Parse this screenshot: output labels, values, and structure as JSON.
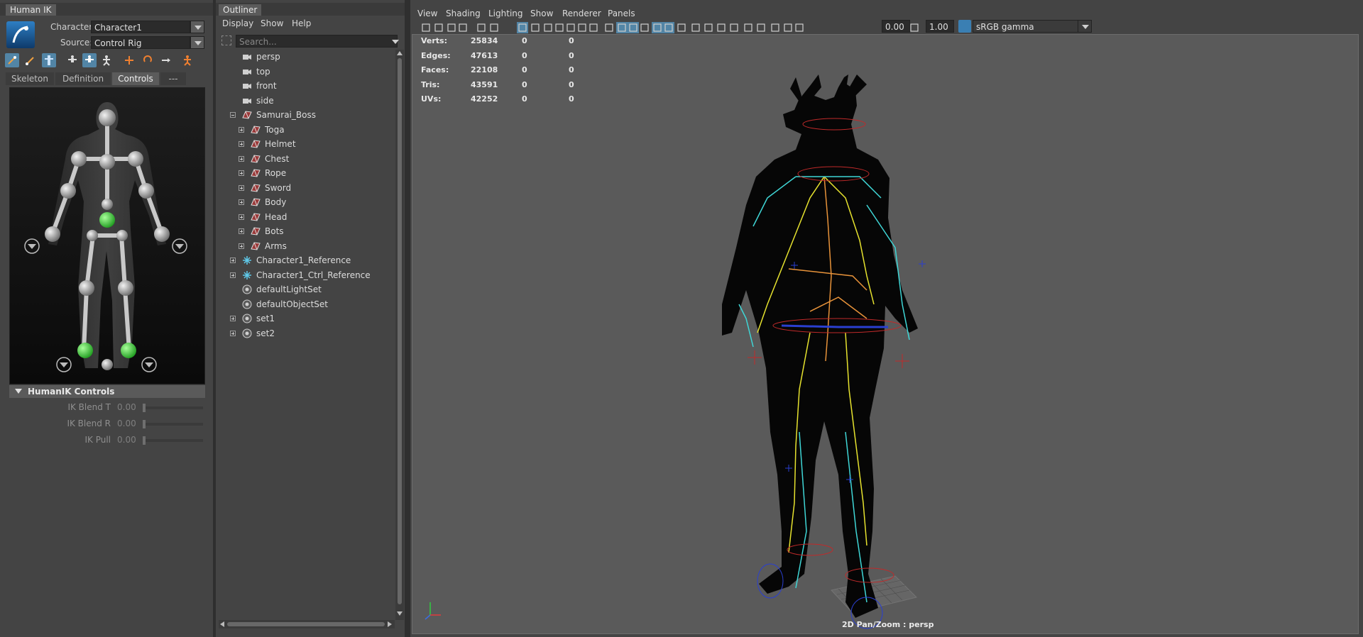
{
  "humanik": {
    "tab_title": "Human IK",
    "character_label": "Character:",
    "character_value": "Character1",
    "source_label": "Source:",
    "source_value": "Control Rig",
    "subtabs": [
      "Skeleton",
      "Definition",
      "Controls",
      "---"
    ],
    "selected_subtab": "Controls",
    "controls_section_title": "HumanIK Controls",
    "sliders": [
      {
        "label": "IK Blend T",
        "value": "0.00"
      },
      {
        "label": "IK Blend R",
        "value": "0.00"
      },
      {
        "label": "IK Pull",
        "value": "0.00"
      }
    ],
    "toolbar_icons": [
      "pin-icon",
      "bone-icon",
      "full-body-icon",
      "body-part-icon",
      "selected-body-icon",
      "stance-icon",
      "pin-translate-icon",
      "pin-rotate-icon",
      "unpin-icon",
      "character-icon"
    ]
  },
  "outliner": {
    "tab_title": "Outliner",
    "menu": [
      "Display",
      "Show",
      "Help"
    ],
    "search_placeholder": "Search...",
    "items": [
      {
        "label": "persp",
        "type": "camera",
        "indent": 0,
        "expander": "none"
      },
      {
        "label": "top",
        "type": "camera",
        "indent": 0,
        "expander": "none"
      },
      {
        "label": "front",
        "type": "camera",
        "indent": 0,
        "expander": "none"
      },
      {
        "label": "side",
        "type": "camera",
        "indent": 0,
        "expander": "none"
      },
      {
        "label": "Samurai_Boss",
        "type": "mesh",
        "indent": 0,
        "expander": "minus"
      },
      {
        "label": "Toga",
        "type": "mesh",
        "indent": 1,
        "expander": "plus"
      },
      {
        "label": "Helmet",
        "type": "mesh",
        "indent": 1,
        "expander": "plus"
      },
      {
        "label": "Chest",
        "type": "mesh",
        "indent": 1,
        "expander": "plus"
      },
      {
        "label": "Rope",
        "type": "mesh",
        "indent": 1,
        "expander": "plus"
      },
      {
        "label": "Sword",
        "type": "mesh",
        "indent": 1,
        "expander": "plus"
      },
      {
        "label": "Body",
        "type": "mesh",
        "indent": 1,
        "expander": "plus"
      },
      {
        "label": "Head",
        "type": "mesh",
        "indent": 1,
        "expander": "plus"
      },
      {
        "label": "Bots",
        "type": "mesh",
        "indent": 1,
        "expander": "plus"
      },
      {
        "label": "Arms",
        "type": "mesh",
        "indent": 1,
        "expander": "plus"
      },
      {
        "label": "Character1_Reference",
        "type": "reference",
        "indent": 0,
        "expander": "plus"
      },
      {
        "label": "Character1_Ctrl_Reference",
        "type": "reference",
        "indent": 0,
        "expander": "plus"
      },
      {
        "label": "defaultLightSet",
        "type": "set",
        "indent": 0,
        "expander": "none"
      },
      {
        "label": "defaultObjectSet",
        "type": "set",
        "indent": 0,
        "expander": "none"
      },
      {
        "label": "set1",
        "type": "set",
        "indent": 0,
        "expander": "plus"
      },
      {
        "label": "set2",
        "type": "set",
        "indent": 0,
        "expander": "plus"
      }
    ]
  },
  "viewport": {
    "menu": [
      "View",
      "Shading",
      "Lighting",
      "Show",
      "Renderer",
      "Panels"
    ],
    "exposure_value": "0.00",
    "gamma_value": "1.00",
    "color_space": "sRGB gamma",
    "stats": [
      {
        "label": "Verts:",
        "values": [
          "25834",
          "0",
          "0"
        ]
      },
      {
        "label": "Edges:",
        "values": [
          "47613",
          "0",
          "0"
        ]
      },
      {
        "label": "Faces:",
        "values": [
          "22108",
          "0",
          "0"
        ]
      },
      {
        "label": "Tris:",
        "values": [
          "43591",
          "0",
          "0"
        ]
      },
      {
        "label": "UVs:",
        "values": [
          "42252",
          "0",
          "0"
        ]
      }
    ],
    "status_text": "2D Pan/Zoom : persp",
    "colors": {
      "background": "#5a5a5a",
      "skeleton_yellow": "#e6e22e",
      "skeleton_cyan": "#3fd6d6",
      "skeleton_orange": "#e8933a",
      "ik_red": "#c02a2a",
      "ik_blue": "#2a3fd0"
    }
  }
}
